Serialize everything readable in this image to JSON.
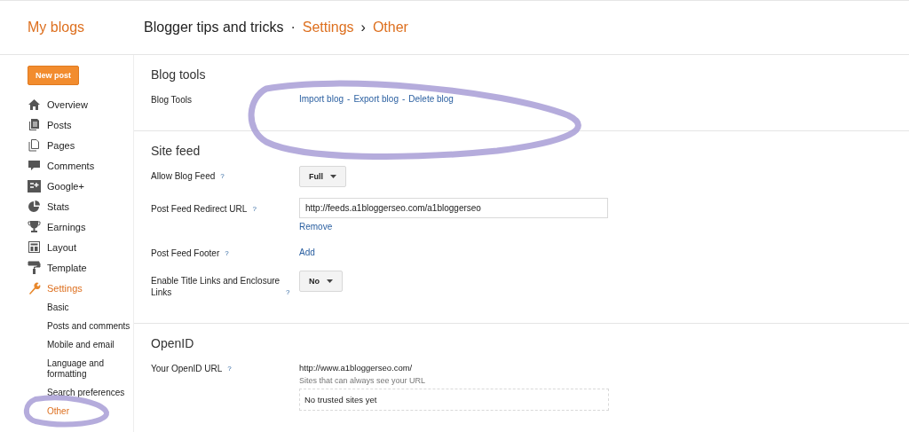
{
  "header": {
    "title": "My blogs",
    "breadcrumb": [
      {
        "kind": "text",
        "text": "Blogger tips and tricks"
      },
      {
        "kind": "sep",
        "text": "·"
      },
      {
        "kind": "link",
        "text": "Settings"
      },
      {
        "kind": "sep",
        "text": "›"
      },
      {
        "kind": "link",
        "text": "Other"
      }
    ]
  },
  "sidebar": {
    "new_post": "New post",
    "items": [
      {
        "label": "Overview",
        "selected": false
      },
      {
        "label": "Posts",
        "selected": false
      },
      {
        "label": "Pages",
        "selected": false
      },
      {
        "label": "Comments",
        "selected": false
      },
      {
        "label": "Google+",
        "selected": false
      },
      {
        "label": "Stats",
        "selected": false
      },
      {
        "label": "Earnings",
        "selected": false
      },
      {
        "label": "Layout",
        "selected": false
      },
      {
        "label": "Template",
        "selected": false
      },
      {
        "label": "Settings",
        "selected": true,
        "children": [
          {
            "label": "Basic",
            "selected": false
          },
          {
            "label": "Posts and comments",
            "selected": false
          },
          {
            "label": "Mobile and email",
            "selected": false
          },
          {
            "label": "Language and formatting",
            "selected": false
          },
          {
            "label": "Search preferences",
            "selected": false
          },
          {
            "label": "Other",
            "selected": true
          }
        ]
      }
    ]
  },
  "sections": [
    {
      "title": "Blog tools",
      "rows": [
        {
          "kind": "links",
          "label": "Blog Tools",
          "links": [
            "Import blog",
            "Export blog",
            "Delete blog"
          ],
          "separator": "-"
        }
      ]
    },
    {
      "title": "Site feed",
      "rows": [
        {
          "kind": "select",
          "label": "Allow Blog Feed",
          "help": "?",
          "value": "Full"
        },
        {
          "kind": "field",
          "label": "Post Feed Redirect URL",
          "help": "?",
          "value": "http://feeds.a1bloggerseo.com/a1bloggerseo",
          "link": "Remove"
        },
        {
          "kind": "link",
          "label": "Post Feed Footer",
          "help": "?",
          "link": "Add"
        },
        {
          "kind": "select",
          "label": "Enable Title Links and Enclosure Links",
          "help": "?",
          "value": "No"
        }
      ]
    },
    {
      "title": "OpenID",
      "rows": [
        {
          "kind": "openid",
          "label": "Your OpenID URL",
          "help": "?",
          "value": "http://www.a1bloggerseo.com/",
          "note": "Sites that can always see your URL",
          "box": "No trusted sites yet"
        }
      ]
    }
  ]
}
